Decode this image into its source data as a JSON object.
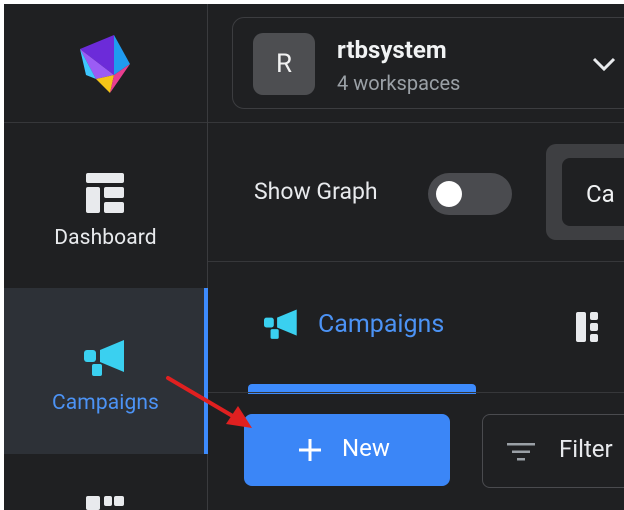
{
  "sidebar": {
    "items": [
      {
        "label": "Dashboard",
        "icon": "dashboard-icon"
      },
      {
        "label": "Campaigns",
        "icon": "campaigns-megaphone-icon",
        "active": true
      }
    ]
  },
  "workspace": {
    "avatar_letter": "R",
    "name": "rtbsystem",
    "count_text": "4 workspaces"
  },
  "toolbar": {
    "show_graph_label": "Show Graph",
    "show_graph_on": false,
    "camp_text": "Ca"
  },
  "tabs": [
    {
      "label": "Campaigns",
      "active": true
    }
  ],
  "actions": {
    "new_label": "New",
    "filter_label": "Filter"
  },
  "colors": {
    "accent": "#3d8bfd",
    "background": "#1f2022",
    "annotation_arrow": "#e02020"
  }
}
